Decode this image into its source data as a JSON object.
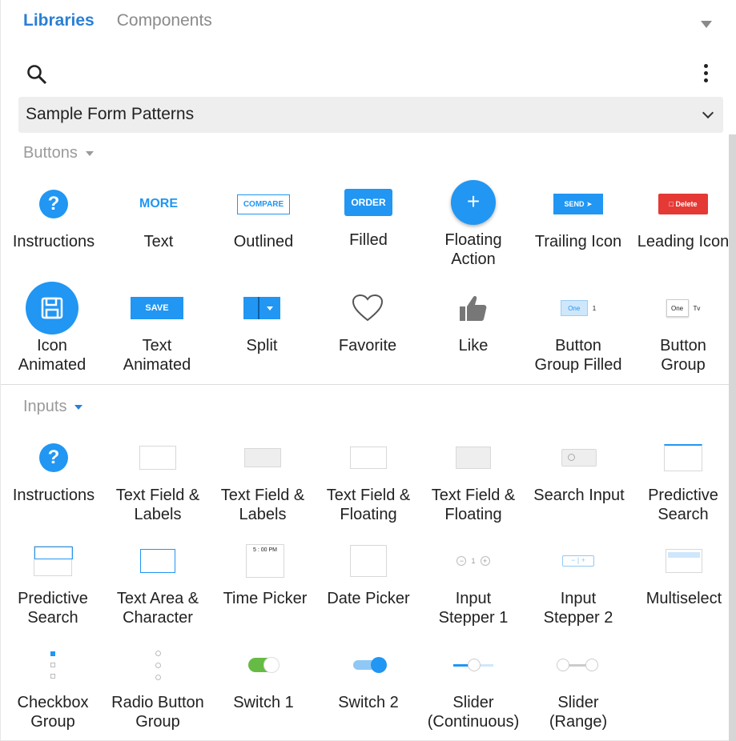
{
  "tabs": {
    "active": "Libraries",
    "other": "Components"
  },
  "library_select": {
    "value": "Sample Form Patterns"
  },
  "sections": {
    "buttons": {
      "title": "Buttons",
      "items": [
        {
          "label": "Instructions"
        },
        {
          "label": "Text",
          "thumb_text": "MORE"
        },
        {
          "label": "Outlined",
          "thumb_text": "COMPARE"
        },
        {
          "label": "Filled",
          "thumb_text": "ORDER"
        },
        {
          "label": "Floating\nAction",
          "thumb_text": "+"
        },
        {
          "label": "Trailing Icon",
          "thumb_text": "SEND"
        },
        {
          "label": "Leading Icon",
          "thumb_text": "Delete"
        },
        {
          "label": "Icon\nAnimated"
        },
        {
          "label": "Text\nAnimated",
          "thumb_text": "SAVE"
        },
        {
          "label": "Split"
        },
        {
          "label": "Favorite"
        },
        {
          "label": "Like"
        },
        {
          "label": "Button\nGroup Filled",
          "thumb_text": "One",
          "thumb_text2": "1"
        },
        {
          "label": "Button\nGroup",
          "thumb_text": "One",
          "thumb_text2": "Tv"
        }
      ]
    },
    "inputs": {
      "title": "Inputs",
      "items": [
        {
          "label": "Instructions"
        },
        {
          "label": "Text Field &\nLabels"
        },
        {
          "label": "Text Field &\nLabels"
        },
        {
          "label": "Text Field &\nFloating"
        },
        {
          "label": "Text Field &\nFloating"
        },
        {
          "label": "Search Input"
        },
        {
          "label": "Predictive\nSearch"
        },
        {
          "label": "Predictive\nSearch"
        },
        {
          "label": "Text Area &\nCharacter"
        },
        {
          "label": "Time Picker",
          "thumb_text": "5 : 00 PM"
        },
        {
          "label": "Date Picker"
        },
        {
          "label": "Input\nStepper 1"
        },
        {
          "label": "Input\nStepper 2"
        },
        {
          "label": "Multiselect"
        },
        {
          "label": "Checkbox\nGroup"
        },
        {
          "label": "Radio Button\nGroup"
        },
        {
          "label": "Switch 1"
        },
        {
          "label": "Switch 2"
        },
        {
          "label": "Slider\n(Continuous)"
        },
        {
          "label": "Slider\n(Range)"
        }
      ]
    }
  },
  "colors": {
    "accent": "#2196f3",
    "tab_active": "#2a7fd4",
    "danger": "#e53935",
    "switch_green": "#66bb45"
  }
}
